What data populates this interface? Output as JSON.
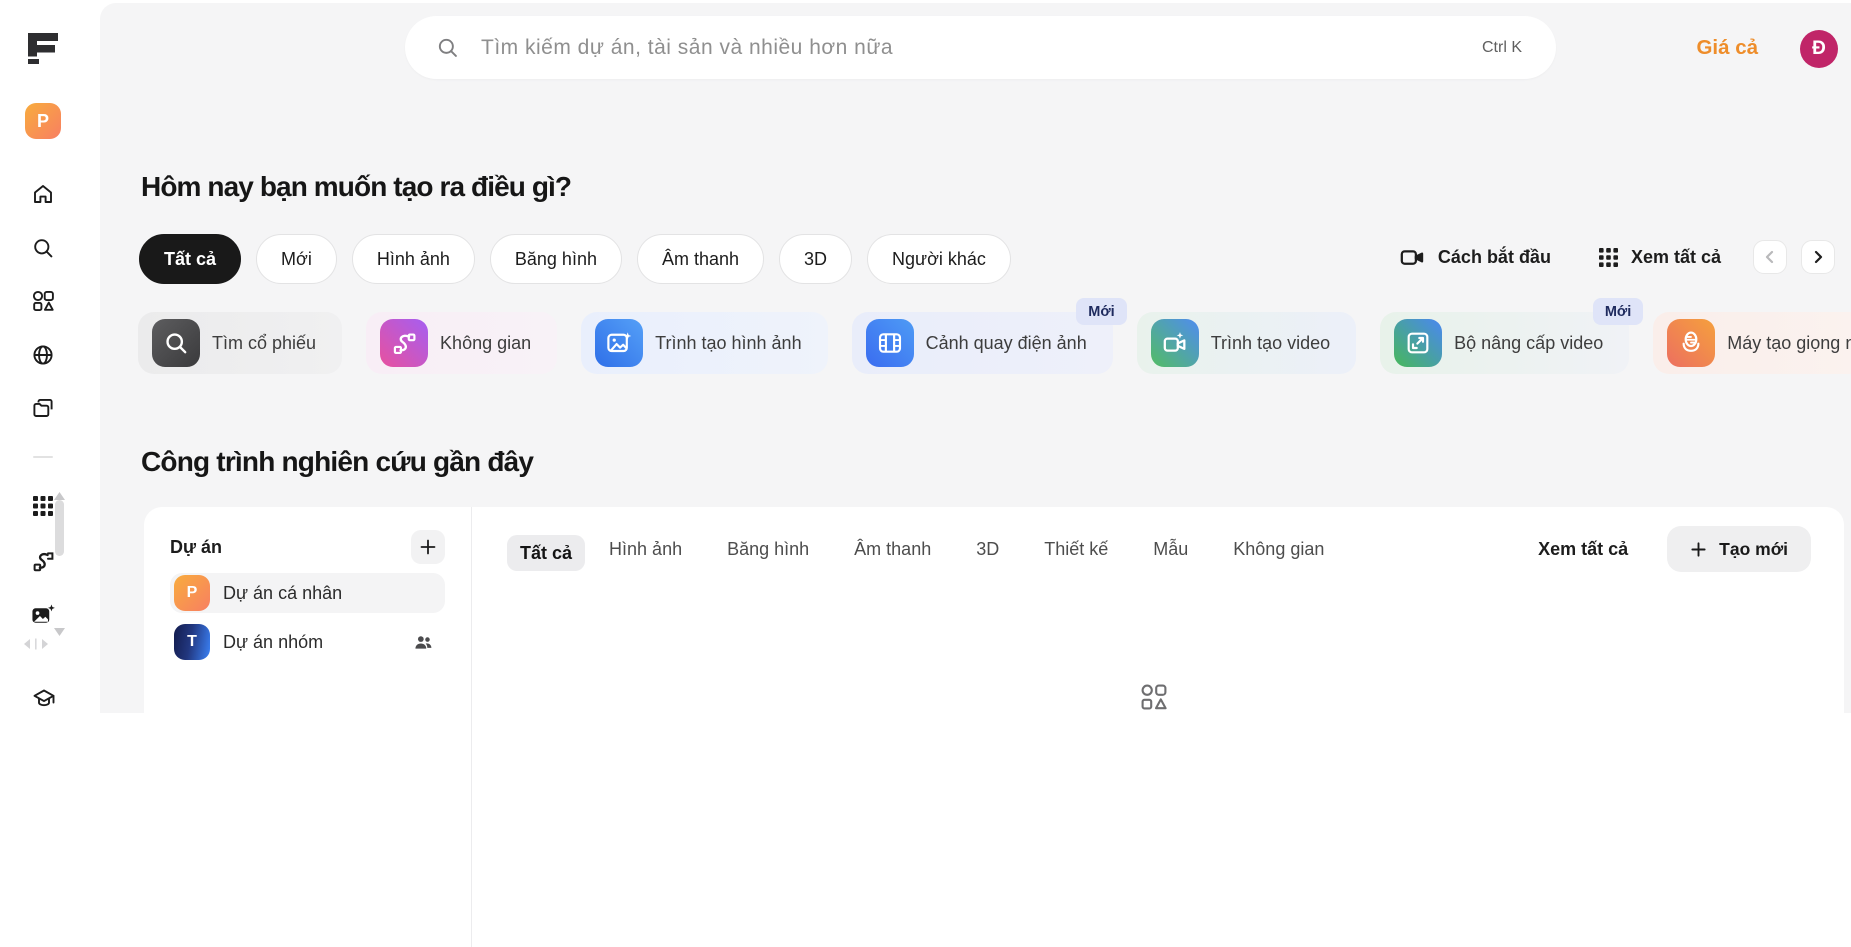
{
  "app": {
    "name": "Freepik",
    "logo_letter": "F"
  },
  "topbar": {
    "search": {
      "placeholder": "Tìm kiếm dự án, tài sản và nhiều hơn nữa",
      "shortcut": "Ctrl K"
    },
    "pricing_label": "Giá cả",
    "avatar_initial": "Đ"
  },
  "sidebar": {
    "project_chip_initial": "P",
    "nav_icons": [
      "home",
      "search",
      "shapes",
      "globe",
      "folders"
    ],
    "tool_icons": [
      "apps-grid",
      "vector-path",
      "image-sparkle"
    ],
    "bottom_icon": "graduation-cap"
  },
  "hero": {
    "title": "Hôm nay bạn muốn tạo ra điều gì?",
    "filters": [
      {
        "label": "Tất cả",
        "active": true
      },
      {
        "label": "Mới",
        "active": false
      },
      {
        "label": "Hình ảnh",
        "active": false
      },
      {
        "label": "Băng hình",
        "active": false
      },
      {
        "label": "Âm thanh",
        "active": false
      },
      {
        "label": "3D",
        "active": false
      },
      {
        "label": "Người khác",
        "active": false
      }
    ],
    "getting_started_label": "Cách bắt đầu",
    "view_all_label": "Xem tất cả",
    "tools": [
      {
        "label": "Tìm cổ phiếu",
        "icon": "stock-search",
        "badge": ""
      },
      {
        "label": "Không gian",
        "icon": "spaces",
        "badge": ""
      },
      {
        "label": "Trình tạo hình ảnh",
        "icon": "image-generator",
        "badge": ""
      },
      {
        "label": "Cảnh quay điện ảnh",
        "icon": "cinematic-frames",
        "badge": "Mới"
      },
      {
        "label": "Trình tạo video",
        "icon": "video-generator",
        "badge": ""
      },
      {
        "label": "Bộ nâng cấp video",
        "icon": "video-upscaler",
        "badge": "Mới"
      },
      {
        "label": "Máy tạo giọng nói",
        "icon": "voice-generator",
        "badge": ""
      }
    ]
  },
  "recent": {
    "title": "Công trình nghiên cứu gần đây",
    "projects_panel": {
      "header": "Dự án",
      "items": [
        {
          "label": "Dự án cá nhân",
          "initial": "P",
          "selected": true,
          "shared": false
        },
        {
          "label": "Dự án nhóm",
          "initial": "T",
          "selected": false,
          "shared": true
        }
      ]
    },
    "tabs": [
      {
        "label": "Tất cả",
        "active": true
      },
      {
        "label": "Hình ảnh",
        "active": false
      },
      {
        "label": "Băng hình",
        "active": false
      },
      {
        "label": "Âm thanh",
        "active": false
      },
      {
        "label": "3D",
        "active": false
      },
      {
        "label": "Thiết kế",
        "active": false
      },
      {
        "label": "Mẫu",
        "active": false
      },
      {
        "label": "Không gian",
        "active": false
      }
    ],
    "view_all_label": "Xem tất cả",
    "create_label": "Tạo mới"
  },
  "colors": {
    "page_bg": "#f5f5f6",
    "accent_orange": "#ee8d2a",
    "avatar_bg": "#c02568",
    "badge_bg": "#dfe4f8",
    "badge_text": "#1e2a5e",
    "pill_active_bg": "#191919",
    "pill_active_text": "#ffffff",
    "chip_p": {
      "from": "#f8ac3d",
      "to": "#f87f62"
    },
    "chip_t": {
      "from": "#131c4d",
      "mid": "#22377f",
      "to": "#3b82f6"
    }
  }
}
